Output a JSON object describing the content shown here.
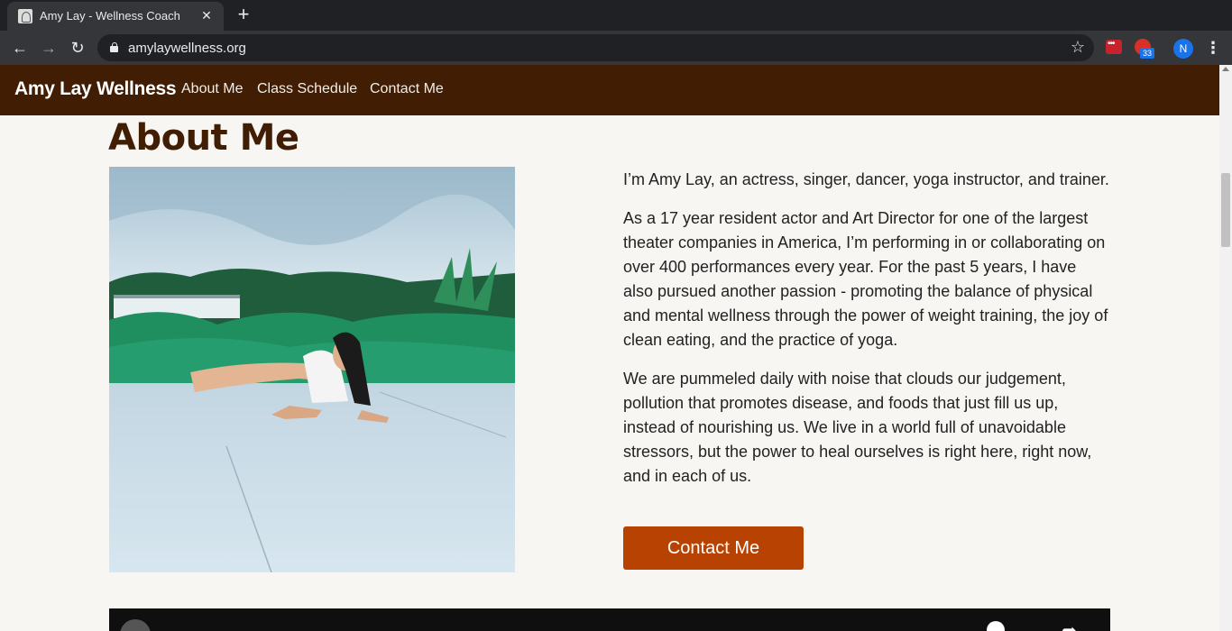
{
  "browser": {
    "tab_title": "Amy Lay - Wellness Coach",
    "tab_close": "✕",
    "new_tab": "+",
    "url": "amylaywellness.org",
    "extension_badge": "33",
    "profile_initial": "N"
  },
  "site": {
    "brand": "Amy Lay Wellness",
    "nav": [
      "About Me",
      "Class Schedule",
      "Contact Me"
    ]
  },
  "main": {
    "title": "About Me",
    "paragraphs": [
      "I’m Amy Lay, an actress, singer, dancer, yoga instructor, and trainer.",
      "As a 17 year resident actor and Art Director for one of the largest theater companies in America, I’m performing in or collaborating on over 400 performances every year. For the past 5 years, I have also pursued another passion - promoting the balance of physical and mental wellness through the power of weight training, the joy of clean eating, and the practice of yoga.",
      "We are pummeled daily with noise that clouds our judgement, pollution that promotes disease, and foods that just fill us up, instead of nourishing us. We live in a world full of unavoidable stressors, but the power to heal ourselves is right here, right now, and in each of us."
    ],
    "contact_button": "Contact Me"
  },
  "colors": {
    "nav_bg": "#411d04",
    "button_bg": "#b84202",
    "page_bg": "#f8f6f3"
  }
}
